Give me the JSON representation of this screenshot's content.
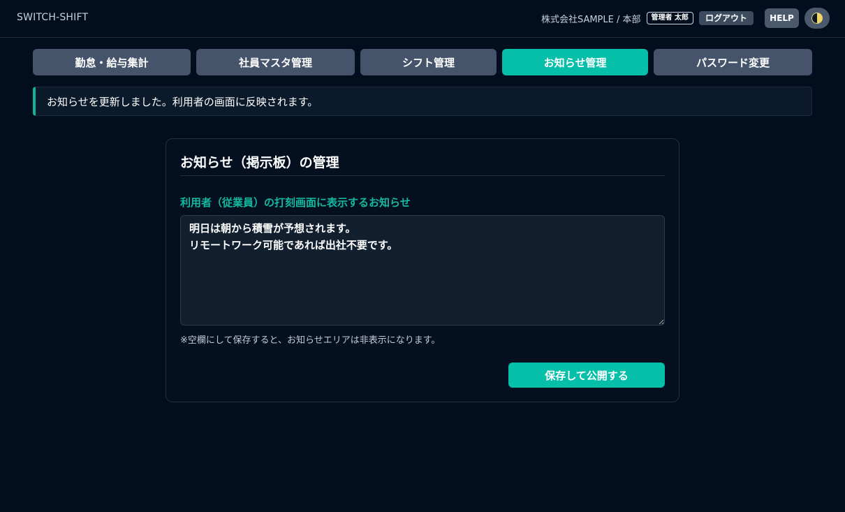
{
  "app": {
    "title": "SWITCH-SHIFT"
  },
  "header": {
    "company": "株式会社SAMPLE / 本部",
    "user_badge": "管理者 太郎",
    "logout_label": "ログアウト",
    "help_label": "HELP",
    "theme_icon": "half-moon-icon"
  },
  "tabs": [
    {
      "label": "勤怠・給与集計",
      "active": false
    },
    {
      "label": "社員マスタ管理",
      "active": false
    },
    {
      "label": "シフト管理",
      "active": false
    },
    {
      "label": "お知らせ管理",
      "active": true
    },
    {
      "label": "パスワード変更",
      "active": false
    }
  ],
  "banner": {
    "message": "お知らせを更新しました。利用者の画面に反映されます。"
  },
  "panel": {
    "title": "お知らせ（掲示板）の管理",
    "field_label": "利用者（従業員）の打刻画面に表示するお知らせ",
    "textarea_value": "明日は朝から積雪が予想されます。\nリモートワーク可能であれば出社不要です。",
    "hint": "※空欄にして保存すると、お知らせエリアは非表示になります。",
    "save_label": "保存して公開する"
  },
  "colors": {
    "background": "#020d1d",
    "accent": "#06bfa8",
    "tab_inactive": "#45546a",
    "label_accent": "#14b8a0"
  }
}
